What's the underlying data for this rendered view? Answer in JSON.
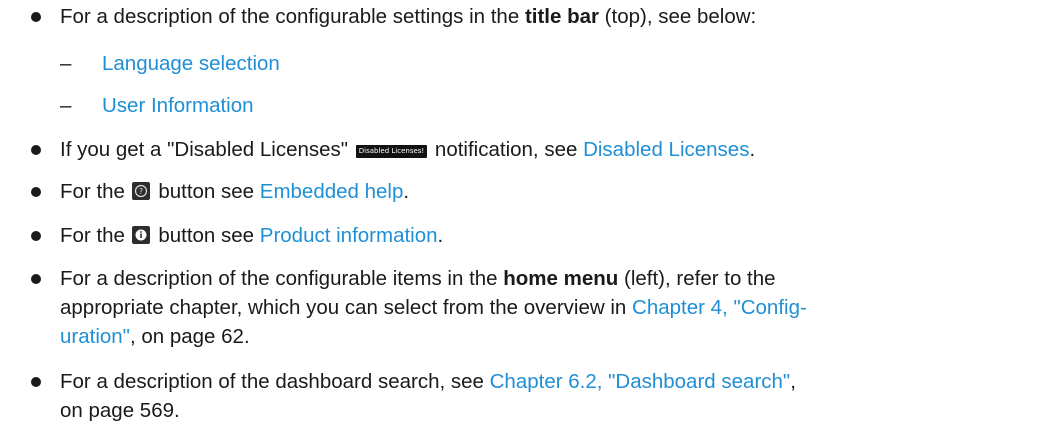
{
  "bullets": {
    "b1": {
      "prefix": "For a description of the configurable settings in the ",
      "bold": "title bar",
      "suffix": " (top), see below:"
    },
    "b1_sub": [
      {
        "dash": "–",
        "link": "Language selection"
      },
      {
        "dash": "–",
        "link": "User Information"
      }
    ],
    "b2": {
      "prefix": "If you get a \"Disabled Licenses\" ",
      "badge": "Disabled Licenses!",
      "middle": " notification, see ",
      "link": "Disabled Licenses",
      "suffix": "."
    },
    "b3": {
      "prefix": "For the ",
      "icon": "help-icon",
      "middle": " button see ",
      "link": "Embedded help",
      "suffix": "."
    },
    "b4": {
      "prefix": "For the ",
      "icon": "info-icon",
      "middle": " button see ",
      "link": "Product information",
      "suffix": "."
    },
    "b5": {
      "line1_prefix": "For a description of the configurable items in the ",
      "line1_bold": "home menu",
      "line1_suffix": " (left), refer to the",
      "line2_prefix": "appropriate chapter, which you can select from the overview in ",
      "line2_link": "Chapter 4, \"Config-",
      "line3_link": "uration\"",
      "line3_suffix": ", on page 62."
    },
    "b6": {
      "line1_prefix": "For a description of the dashboard search, see ",
      "line1_link": "Chapter 6.2, \"Dashboard search\"",
      "line1_suffix": ",",
      "line2": "on page 569."
    }
  },
  "colors": {
    "link": "#1f8fd6",
    "text": "#1a1a1a",
    "icon_bg": "#2d2d2d"
  }
}
